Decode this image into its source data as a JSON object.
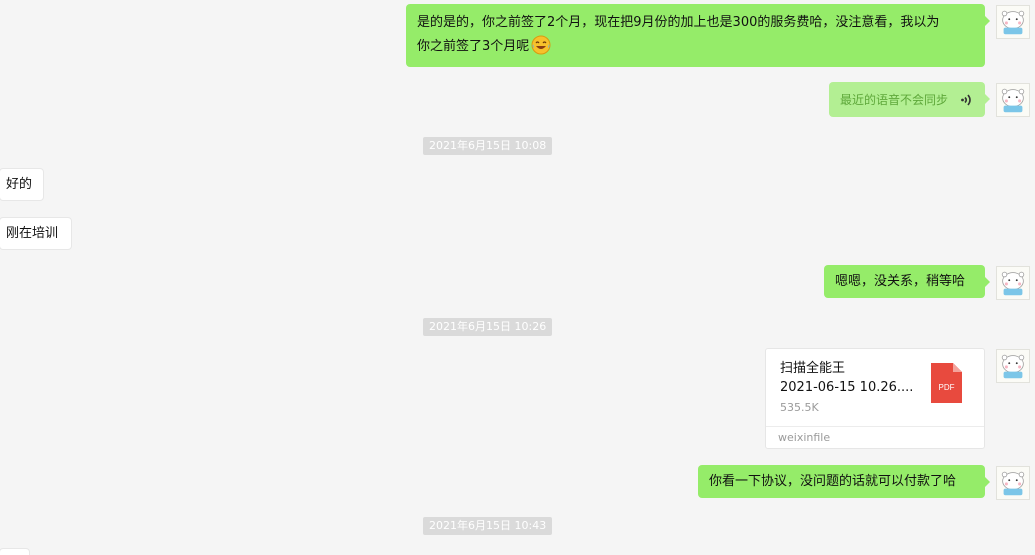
{
  "messages": {
    "m1": {
      "line1": "是的是的，你之前签了2个月，现在把9月份的加上也是300的服务费哈，没注意看，我以为",
      "line2": "你之前签了3个月呢"
    },
    "m2": {
      "text": "最近的语音不会同步"
    },
    "m3": {
      "text": "好的"
    },
    "m4": {
      "text": "刚在培训"
    },
    "m5": {
      "text": "嗯嗯，没关系，稍等哈"
    },
    "m6": {
      "file_name_line1": "扫描全能王",
      "file_name_line2": "2021-06-15 10.26....",
      "file_size": "535.5K",
      "source": "weixinfile",
      "icon_label": "PDF"
    },
    "m7": {
      "text": "你看一下协议，没问题的话就可以付款了哈"
    }
  },
  "timestamps": {
    "t1": "2021年6月15日 10:08",
    "t2": "2021年6月15日 10:26",
    "t3": "2021年6月15日 10:43"
  },
  "icons": {
    "emoji": "laugh-cry-emoji",
    "voice": "voice-wave-icon",
    "file": "pdf-file-icon",
    "avatar": "cartoon-avatar"
  },
  "colors": {
    "outgoing_bubble": "#95ec69",
    "incoming_bubble": "#ffffff",
    "timestamp_bg": "#dadada",
    "pdf_red": "#e84a3e",
    "background": "#f5f5f5"
  }
}
